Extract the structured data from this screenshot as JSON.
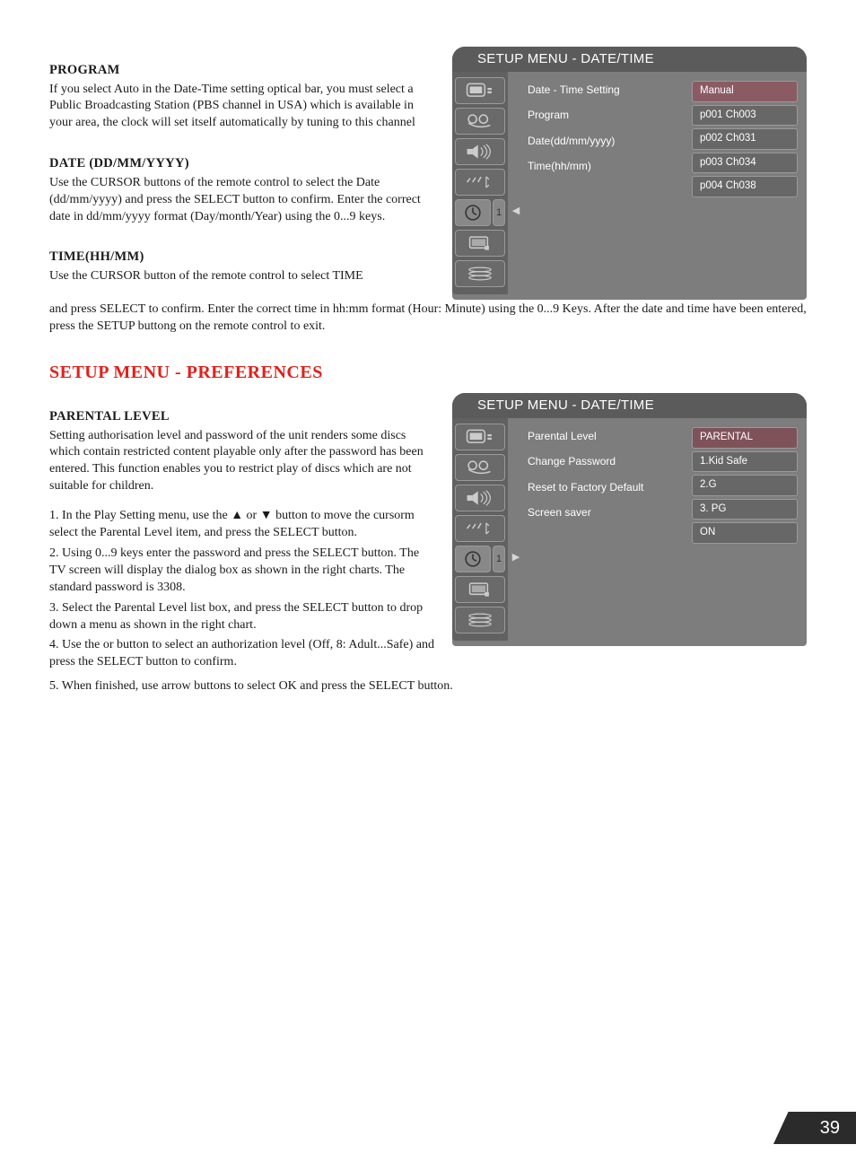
{
  "program": {
    "heading": "PROGRAM",
    "body": "If you select Auto in the Date-Time setting optical bar, you must select a Public Broadcasting Station (PBS channel in USA) which is available in your area, the clock will set itself automatically by tuning to this channel"
  },
  "date": {
    "heading": "DATE (DD/MM/YYYY)",
    "body": "Use the CURSOR buttons of the remote control to select the Date (dd/mm/yyyy) and press the SELECT button to confirm. Enter the correct date in dd/mm/yyyy format (Day/month/Year) using the 0...9 keys."
  },
  "time": {
    "heading": "TIME(HH/MM)",
    "body1": "Use the CURSOR button of the remote control to select TIME",
    "body2": "and press SELECT to confirm. Enter the correct time in hh:mm format (Hour: Minute) using the 0...9 Keys. After the date and time have been entered, press the SETUP buttong on the remote control to exit."
  },
  "prefs_heading": "SETUP MENU - PREFERENCES",
  "parental": {
    "heading": "PARENTAL LEVEL",
    "body": "Setting authorisation level and password of the unit renders some discs which contain restricted content playable only after the password has been entered. This function enables you to restrict play of discs which are not suitable for children.",
    "steps": {
      "s1": "1. In the Play Setting menu, use the ▲ or ▼ button to move the cursorm select the Parental Level item, and press the SELECT button.",
      "s2": "2. Using 0...9 keys enter the password and press the SELECT button. The TV screen will display the dialog box as shown in the right charts. The standard password is 3308.",
      "s3": "3. Select the Parental Level list box, and press the SELECT button to drop down a menu as shown in the right chart.",
      "s4": "4. Use the   or   button to select an authorization level (Off, 8: Adult...Safe) and press the SELECT button to confirm.",
      "s5": "5. When finished, use arrow buttons to select OK and press the SELECT button."
    }
  },
  "panel1": {
    "title": "SETUP MENU - DATE/TIME",
    "menu": [
      "Date - Time Setting",
      "Program",
      "Date(dd/mm/yyyy)",
      "Time(hh/mm)"
    ],
    "opts": [
      "Manual",
      "p001 Ch003",
      "p002 Ch031",
      "p003 Ch034",
      "p004 Ch038"
    ],
    "arrow": "◀",
    "active_index": "1"
  },
  "panel2": {
    "title": "SETUP MENU - DATE/TIME",
    "menu": [
      "Parental Level",
      "Change Password",
      "Reset to Factory Default",
      "Screen saver"
    ],
    "head": "PARENTAL",
    "opts": [
      "1.Kid Safe",
      "2.G",
      "3. PG",
      "ON"
    ],
    "arrow": "▶",
    "active_index": "1"
  },
  "page_number": "39"
}
